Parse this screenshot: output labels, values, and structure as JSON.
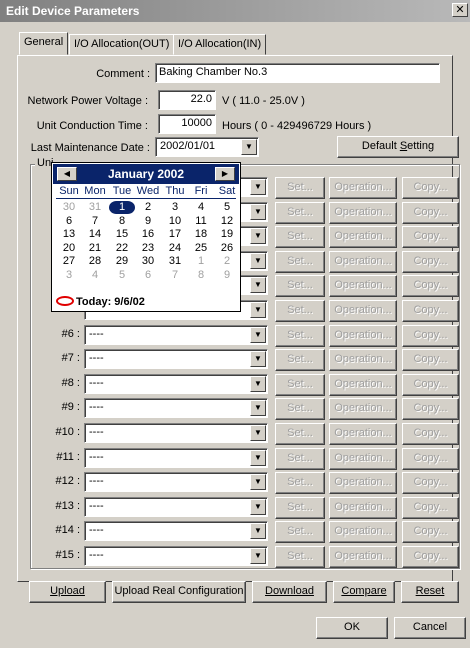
{
  "window": {
    "title": "Edit Device Parameters",
    "close": "✕"
  },
  "tabs": [
    "General",
    "I/O Allocation(OUT)",
    "I/O Allocation(IN)"
  ],
  "fields": {
    "comment_label": "Comment :",
    "comment_value": "Baking Chamber No.3",
    "voltage_label": "Network Power Voltage :",
    "voltage_value": "22.0",
    "voltage_unit": "V ( 11.0 - 25.0V )",
    "conduction_label": "Unit Conduction Time :",
    "conduction_value": "10000",
    "conduction_unit": "Hours ( 0 - 429496729 Hours )",
    "maintenance_label": "Last Maintenance Date :",
    "maintenance_value": "2002/01/01",
    "default_setting": "Default Setting",
    "default_setting_key": "S"
  },
  "units_group": {
    "label": "Uni"
  },
  "unit_rows": [
    {
      "label": "",
      "value": ""
    },
    {
      "label": "",
      "value": ""
    },
    {
      "label": "",
      "value": ""
    },
    {
      "label": "",
      "value": ""
    },
    {
      "label": "",
      "value": ""
    },
    {
      "label": "",
      "value": ""
    },
    {
      "label": "#6 :",
      "value": "----"
    },
    {
      "label": "#7 :",
      "value": "----"
    },
    {
      "label": "#8 :",
      "value": "----"
    },
    {
      "label": "#9 :",
      "value": "----"
    },
    {
      "label": "#10 :",
      "value": "----"
    },
    {
      "label": "#11 :",
      "value": "----"
    },
    {
      "label": "#12 :",
      "value": "----"
    },
    {
      "label": "#13 :",
      "value": "----"
    },
    {
      "label": "#14 :",
      "value": "----"
    },
    {
      "label": "#15 :",
      "value": "----"
    }
  ],
  "row_buttons": {
    "set": "Set...",
    "operation": "Operation...",
    "copy": "Copy..."
  },
  "calendar": {
    "month": "January 2002",
    "day_names": [
      "Sun",
      "Mon",
      "Tue",
      "Wed",
      "Thu",
      "Fri",
      "Sat"
    ],
    "weeks": [
      [
        "30",
        "31",
        "1",
        "2",
        "3",
        "4",
        "5"
      ],
      [
        "6",
        "7",
        "8",
        "9",
        "10",
        "11",
        "12"
      ],
      [
        "13",
        "14",
        "15",
        "16",
        "17",
        "18",
        "19"
      ],
      [
        "20",
        "21",
        "22",
        "23",
        "24",
        "25",
        "26"
      ],
      [
        "27",
        "28",
        "29",
        "30",
        "31",
        "1",
        "2"
      ],
      [
        "3",
        "4",
        "5",
        "6",
        "7",
        "8",
        "9"
      ]
    ],
    "selected": "1",
    "today": "Today: 9/6/02"
  },
  "bottom_buttons": {
    "upload": "Upload",
    "upload_real": "Upload Real Configuration",
    "download": "Download",
    "compare": "Compare",
    "reset": "Reset"
  },
  "dialog_buttons": {
    "ok": "OK",
    "cancel": "Cancel"
  }
}
